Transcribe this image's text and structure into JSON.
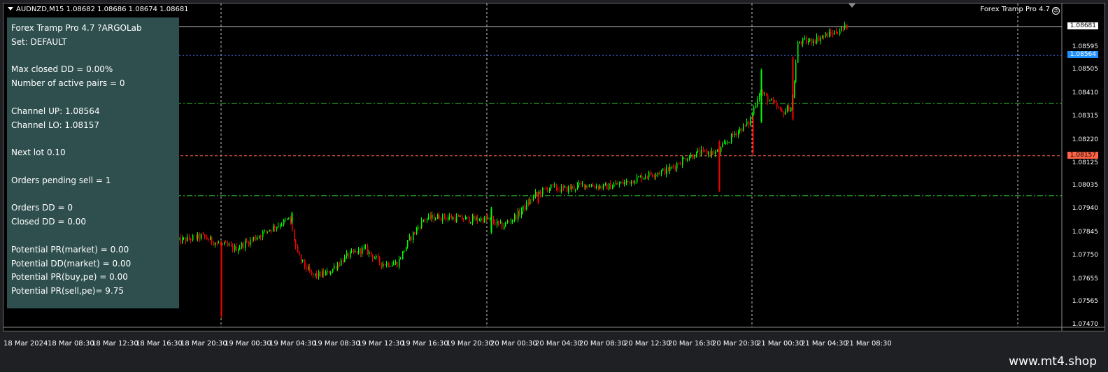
{
  "header": {
    "symbol_line": "AUDNZD,M15  1.08682 1.08686 1.08674 1.08681",
    "ea_name": "Forex Tramp Pro 4.7",
    "ea_icon": "smiley-icon"
  },
  "info_panel": {
    "lines": [
      "Forex Tramp Pro 4.7 ?ARGOLab",
      "Set: DEFAULT",
      "",
      "Max closed DD = 0.00%",
      "Number of active pairs = 0",
      "",
      "Channel UP: 1.08564",
      "Channel LO: 1.08157",
      "",
      "Next lot 0.10",
      "",
      "Orders pending sell = 1",
      "",
      "Orders DD = 0",
      "Closed DD = 0.00",
      "",
      "Potential PR(market) = 0.00",
      "Potential DD(market) = 0.00",
      "Potential PR(buy,pe) = 0.00",
      "Potential PR(sell,pe)= 9.75"
    ]
  },
  "price_axis": {
    "labels": [
      "1.08681",
      "1.08595",
      "1.08564",
      "1.08505",
      "1.08410",
      "1.08315",
      "1.08220",
      "1.08157",
      "1.08125",
      "1.08035",
      "1.07940",
      "1.07845",
      "1.07750",
      "1.07655",
      "1.07565",
      "1.07470"
    ],
    "current_price": "1.08681",
    "channel_up_price": "1.08564",
    "channel_lo_price": "1.08157",
    "min": 1.0747,
    "max": 1.08681
  },
  "time_axis": {
    "labels": [
      "18 Mar 2024",
      "18 Mar 08:30",
      "18 Mar 12:30",
      "18 Mar 16:30",
      "18 Mar 20:30",
      "19 Mar 00:30",
      "19 Mar 04:30",
      "19 Mar 08:30",
      "19 Mar 12:30",
      "19 Mar 16:30",
      "19 Mar 20:30",
      "20 Mar 00:30",
      "20 Mar 04:30",
      "20 Mar 08:30",
      "20 Mar 12:30",
      "20 Mar 16:30",
      "20 Mar 20:30",
      "21 Mar 00:30",
      "21 Mar 04:30",
      "21 Mar 08:30"
    ]
  },
  "levels": {
    "channel_up_color": "#4169e1",
    "channel_lo_color": "#ff6347",
    "green_dash_a": 1.0837,
    "green_dash_b": 1.07995,
    "green_color": "#32cd32"
  },
  "colors": {
    "bull": "#00ff00",
    "bear": "#ff0000",
    "panel_bg": "#2f4f4f"
  },
  "chart_data": {
    "type": "candlestick",
    "trend_points": [
      {
        "t": "18 Mar 20:30",
        "price": 1.0781
      },
      {
        "t": "19 Mar 00:30",
        "price": 1.0779
      },
      {
        "t": "19 Mar 04:30",
        "price": 1.0786
      },
      {
        "t": "19 Mar 08:30",
        "price": 1.0767
      },
      {
        "t": "19 Mar 12:30",
        "price": 1.0772
      },
      {
        "t": "19 Mar 16:30",
        "price": 1.0791
      },
      {
        "t": "19 Mar 20:30",
        "price": 1.0791
      },
      {
        "t": "20 Mar 00:30",
        "price": 1.0796
      },
      {
        "t": "20 Mar 04:30",
        "price": 1.0803
      },
      {
        "t": "20 Mar 08:30",
        "price": 1.0804
      },
      {
        "t": "20 Mar 12:30",
        "price": 1.081
      },
      {
        "t": "20 Mar 16:30",
        "price": 1.0817
      },
      {
        "t": "20 Mar 20:30",
        "price": 1.0829
      },
      {
        "t": "21 Mar 00:30",
        "price": 1.0836
      },
      {
        "t": "21 Mar 04:30",
        "price": 1.0864
      },
      {
        "t": "21 Mar 08:30",
        "price": 1.08681
      }
    ]
  }
}
